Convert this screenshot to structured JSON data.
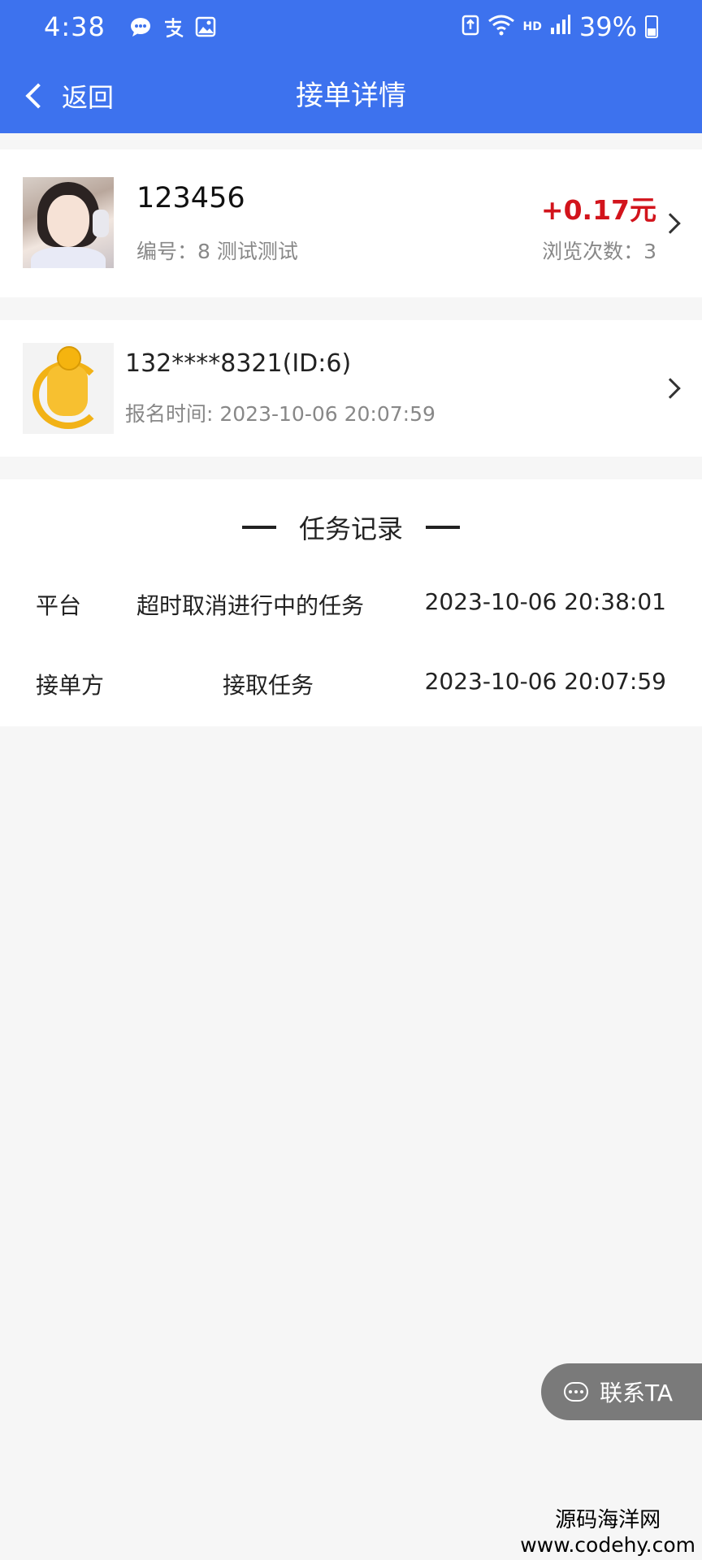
{
  "status_bar": {
    "time": "4:38",
    "left_icons": [
      "chat-icon",
      "alipay-icon",
      "gallery-icon"
    ],
    "right_icons": [
      "upload-icon",
      "wifi-icon",
      "hd-icon",
      "signal-icon"
    ],
    "hd_label": "HD",
    "battery": "39%"
  },
  "nav": {
    "back_label": "返回",
    "title": "接单详情"
  },
  "task": {
    "title": "123456",
    "meta": "编号：8  测试测试",
    "price": "+0.17元",
    "views": "浏览次数：3"
  },
  "user": {
    "name": "132****8321(ID:6)",
    "signup_time": "报名时间: 2023-10-06 20:07:59"
  },
  "records": {
    "title": "任务记录",
    "rows": [
      {
        "who": "平台",
        "what": "超时取消进行中的任务",
        "when": "2023-10-06 20:38:01"
      },
      {
        "who": "接单方",
        "what": "接取任务",
        "when": "2023-10-06 20:07:59"
      }
    ]
  },
  "contact_button": {
    "label": "联系TA"
  },
  "watermark": {
    "name": "源码海洋网",
    "url": "www.codehy.com"
  },
  "colors": {
    "header": "#3d72ee",
    "price": "#d2141c",
    "contact_button": "#7a7a7a"
  }
}
